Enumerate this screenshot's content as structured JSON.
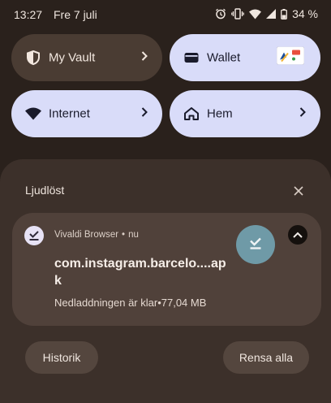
{
  "status_bar": {
    "time": "13:27",
    "date": "Fre 7 juli",
    "battery": "34 %"
  },
  "tiles": [
    {
      "label": "My Vault",
      "icon": "shield-icon",
      "style": "dark"
    },
    {
      "label": "Wallet",
      "icon": "wallet-icon",
      "style": "light"
    },
    {
      "label": "Internet",
      "icon": "wifi-icon",
      "style": "light"
    },
    {
      "label": "Hem",
      "icon": "home-icon",
      "style": "dark"
    }
  ],
  "section": {
    "title": "Ljudlöst"
  },
  "notification": {
    "app_name": "Vivaldi Browser",
    "separator": "•",
    "time": "nu",
    "title": "com.instagram.barcelo....apk",
    "text": "Nedladdningen är klar•77,04 MB"
  },
  "buttons": {
    "history": "Historik",
    "clear_all": "Rensa alla"
  },
  "colors": {
    "background": "#2a211c",
    "tile_dark": "#4a3c33",
    "tile_light": "#d9dcf9",
    "shade": "#3c302a",
    "notification_card": "#50413a",
    "download_button": "#6f9aa7"
  }
}
